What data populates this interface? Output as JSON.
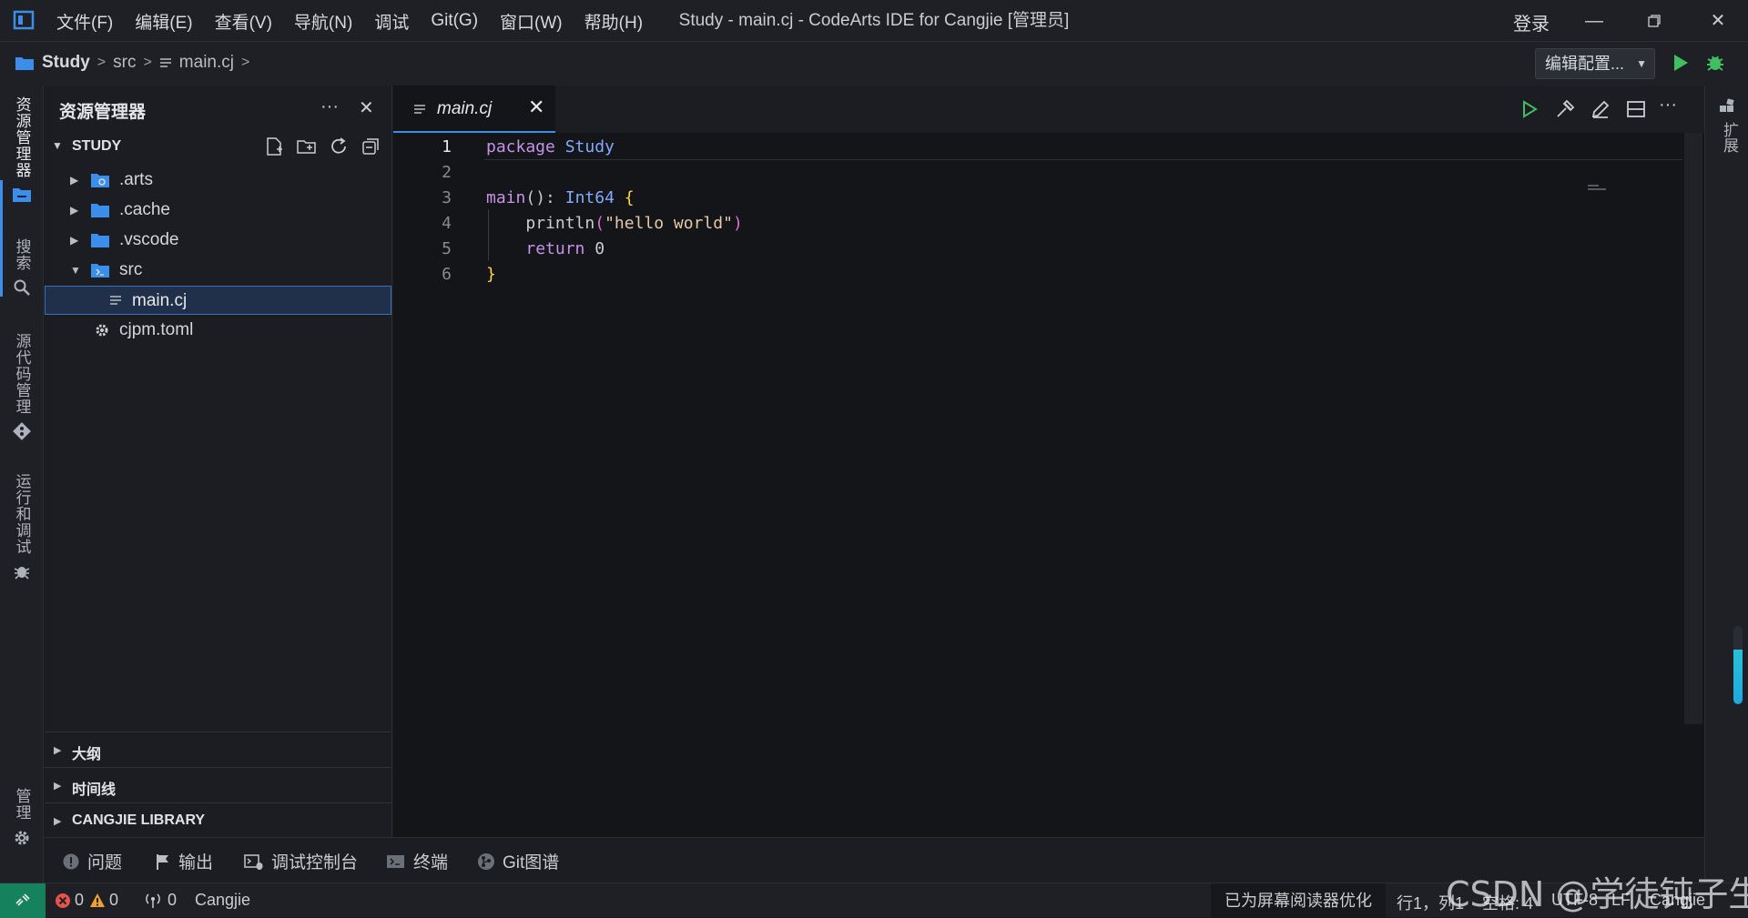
{
  "window": {
    "title": "Study - main.cj - CodeArts IDE for Cangjie [管理员]",
    "login": "登录"
  },
  "menu": {
    "file": "文件(F)",
    "edit": "编辑(E)",
    "view": "查看(V)",
    "navigate": "导航(N)",
    "debug": "调试",
    "git": "Git(G)",
    "window": "窗口(W)",
    "help": "帮助(H)"
  },
  "breadcrumb": {
    "root": "Study",
    "folder": "src",
    "file": "main.cj"
  },
  "run_config": {
    "label": "编辑配置..."
  },
  "activitybar": {
    "explorer": "资源管理器",
    "search": "搜索",
    "scm": "源代码管理",
    "run": "运行和调试",
    "manage": "管理"
  },
  "sidebar": {
    "title": "资源管理器",
    "section_title": "STUDY",
    "tree": [
      {
        "name": ".arts"
      },
      {
        "name": ".cache"
      },
      {
        "name": ".vscode"
      },
      {
        "name": "src"
      },
      {
        "name": "main.cj"
      },
      {
        "name": "cjpm.toml"
      }
    ],
    "outline": "大纲",
    "timeline": "时间线",
    "library": "CANGJIE LIBRARY"
  },
  "editor": {
    "tab_label": "main.cj",
    "lines": [
      {
        "number": "1"
      },
      {
        "number": "2"
      },
      {
        "number": "3"
      },
      {
        "number": "4"
      },
      {
        "number": "5"
      },
      {
        "number": "6"
      }
    ],
    "tokens": {
      "l1_kw": "package",
      "l1_name": "Study",
      "l3_fn": "main",
      "l3_paren": "()",
      "l3_colon": ": ",
      "l3_type": "Int64",
      "l3_brace": "{",
      "l4_fn": "println",
      "l4_paren_open": "(",
      "l4_str": "\"hello world\"",
      "l4_paren_close": ")",
      "l5_kw": "return",
      "l5_num": "0",
      "l6_brace": "}"
    }
  },
  "rightbar": {
    "extensions": "扩展"
  },
  "panel": {
    "problems": "问题",
    "output": "输出",
    "debug_console": "调试控制台",
    "terminal": "终端",
    "git_graph": "Git图谱"
  },
  "status": {
    "errors": "0",
    "warnings": "0",
    "ports": "0",
    "language_mode": "Cangjie",
    "screen_reader": "已为屏幕阅读器优化",
    "position": "行1，列1",
    "spaces": "空格: 4",
    "encoding": "UTF-8",
    "eol": "LF",
    "language": "Cangjie"
  },
  "watermark": "CSDN @学徒钝子生",
  "colors": {
    "accent": "#3b8eea",
    "remote": "#16825d",
    "run_green": "#3fbf5f"
  }
}
